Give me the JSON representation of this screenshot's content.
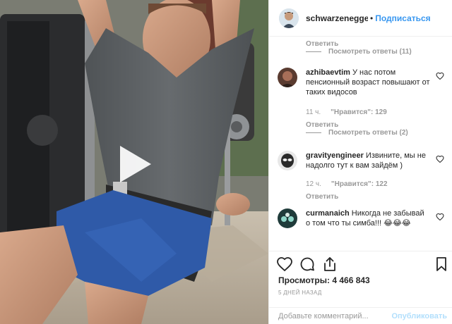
{
  "header": {
    "username": "schwarzenegger",
    "separator": "•",
    "follow_label": "Подписаться"
  },
  "comments_panel": {
    "top_reply_link": "Ответить",
    "top_view_replies": "Посмотреть ответы (11)",
    "comments": [
      {
        "username": "azhibaevtim",
        "text": "У нас потом пенсионный возраст повышают от таких видосов",
        "time": "11 ч.",
        "likes": "\"Нравится\": 129",
        "reply_label": "Ответить",
        "view_replies": "Посмотреть ответы (2)"
      },
      {
        "username": "gravityengineer",
        "text": "Извините, мы не надолго тут к вам зайдём )",
        "time": "12 ч.",
        "likes": "\"Нравится\": 122",
        "reply_label": "Ответить"
      },
      {
        "username": "curmanaich",
        "text": "Никогда не забывай о том что ты симба!!! 😂😂😂"
      }
    ]
  },
  "actions": {
    "icons": [
      "heart-icon",
      "comment-icon",
      "share-icon",
      "bookmark-icon"
    ],
    "likes_count": "Просмотры: 4 466 843",
    "date": "5 ДНЕЙ НАЗАД"
  },
  "comment_box": {
    "placeholder": "Добавьте комментарий...",
    "publish_label": "Опубликовать"
  },
  "colors": {
    "accent": "#3897f0",
    "publish_disabled": "#b2dffc",
    "secondary_text": "#999999",
    "primary_text": "#262626",
    "shirt": "#5f6366",
    "shorts": "#2f5aa8"
  }
}
